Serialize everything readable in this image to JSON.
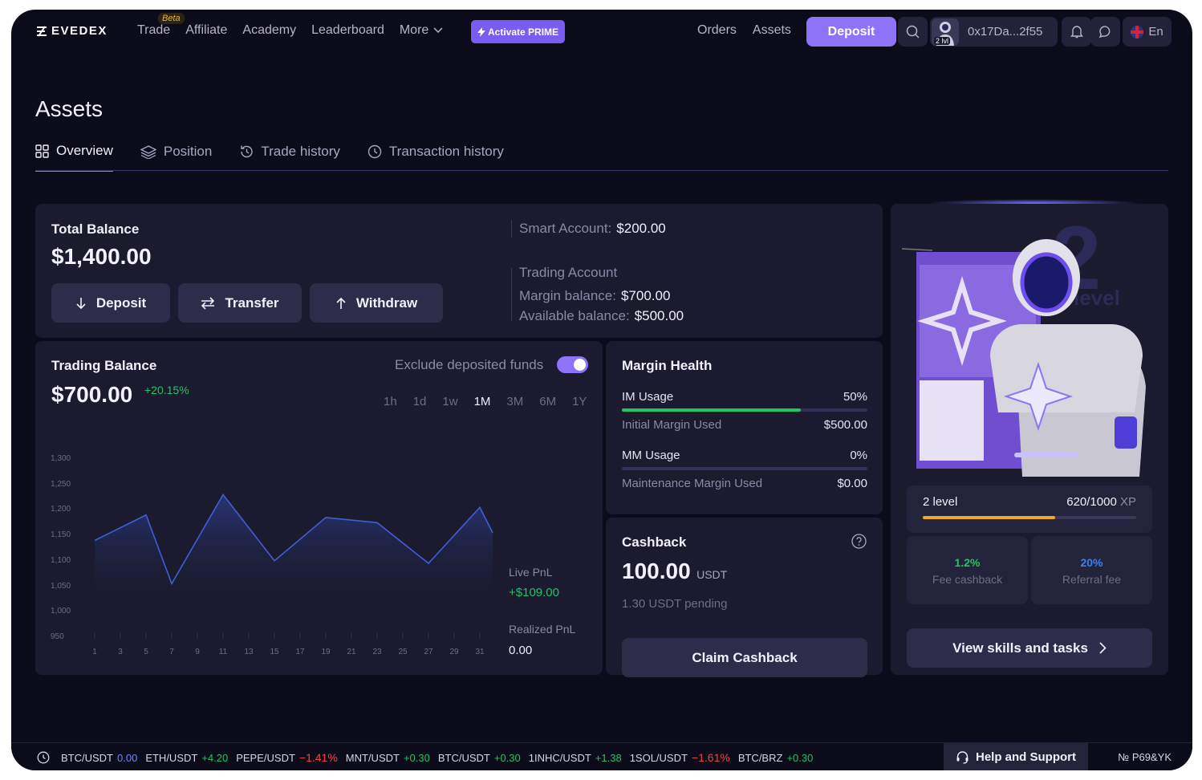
{
  "header": {
    "logo": "EVEDEX",
    "nav": [
      "Trade",
      "Affiliate",
      "Academy",
      "Leaderboard",
      "More"
    ],
    "beta_badge": "Beta",
    "prime_label": "Activate PRIME",
    "links": [
      "Orders",
      "Assets"
    ],
    "deposit_label": "Deposit",
    "avatar_level": "2 lvl",
    "wallet_address": "0x17Da...2f55",
    "language": "En"
  },
  "page": {
    "title": "Assets",
    "tabs": [
      "Overview",
      "Position",
      "Trade history",
      "Transaction history"
    ],
    "active_tab": "Overview"
  },
  "total_balance": {
    "label": "Total Balance",
    "value": "$1,400.00",
    "actions": [
      "Deposit",
      "Transfer",
      "Withdraw"
    ],
    "smart_account_label": "Smart Account:",
    "smart_account_value": "$200.00",
    "trading_account_label": "Trading Account",
    "margin_balance_label": "Margin balance:",
    "margin_balance_value": "$700.00",
    "available_balance_label": "Available balance:",
    "available_balance_value": "$500.00"
  },
  "trading_balance": {
    "label": "Trading Balance",
    "value": "$700.00",
    "change": "+20.15%",
    "exclude_label": "Exclude deposited funds",
    "exclude_enabled": true,
    "periods": [
      "1h",
      "1d",
      "1w",
      "1M",
      "3M",
      "6M",
      "1Y"
    ],
    "selected_period": "1M",
    "live_pnl_label": "Live PnL",
    "live_pnl_value": "+$109.00",
    "realized_pnl_label": "Realized PnL",
    "realized_pnl_value": "0.00"
  },
  "chart_data": {
    "type": "area",
    "x": [
      1,
      3,
      5,
      7,
      9,
      11,
      13,
      15,
      17,
      19,
      21,
      23,
      25,
      27,
      29,
      31
    ],
    "x_points": [
      1,
      5,
      7,
      11,
      15,
      19,
      23,
      27,
      31,
      32
    ],
    "y_points": [
      1140,
      1190,
      1055,
      1230,
      1100,
      1185,
      1175,
      1095,
      1205,
      1155
    ],
    "yticks": [
      1300,
      1250,
      1200,
      1150,
      1100,
      1050,
      1000,
      950
    ],
    "ytick_labels": [
      "1,300",
      "1,250",
      "1,200",
      "1,150",
      "1,100",
      "1,050",
      "1,000",
      "950"
    ],
    "ylim": [
      950,
      1300
    ],
    "xlim": [
      0,
      32
    ],
    "color": "#3f5fd6"
  },
  "margin_health": {
    "title": "Margin Health",
    "im_label": "IM Usage",
    "im_value": "50%",
    "im_fraction": 0.73,
    "initial_label": "Initial Margin Used",
    "initial_value": "$500.00",
    "mm_label": "MM Usage",
    "mm_value": "0%",
    "mm_fraction": 0,
    "maintenance_label": "Maintenance Margin Used",
    "maintenance_value": "$0.00"
  },
  "cashback": {
    "title": "Cashback",
    "value": "100.00",
    "unit": "USDT",
    "pending": "1.30 USDT pending",
    "claim_label": "Claim Cashback"
  },
  "level": {
    "big_number": "2",
    "big_word": "level",
    "level_label": "2 level",
    "xp_value": "620/1000",
    "xp_unit": "XP",
    "xp_fraction": 0.62,
    "fee_cashback_value": "1.2%",
    "fee_cashback_label": "Fee cashback",
    "referral_value": "20%",
    "referral_label": "Referral fee",
    "skills_label": "View skills and tasks"
  },
  "footer": {
    "ticker": [
      {
        "pair": "BTC/USDT",
        "change": "0.00",
        "color": "#6f86ff"
      },
      {
        "pair": "ETH/USDT",
        "change": "+4.20",
        "color": "#22c55e"
      },
      {
        "pair": "PEPE/USDT",
        "change": "−1.41%",
        "color": "#ef4444"
      },
      {
        "pair": "MNT/USDT",
        "change": "+0.30",
        "color": "#22c55e"
      },
      {
        "pair": "BTC/USDT",
        "change": "+0.30",
        "color": "#22c55e"
      },
      {
        "pair": "1INHC/USDT",
        "change": "+1.38",
        "color": "#22c55e"
      },
      {
        "pair": "1SOL/USDT",
        "change": "−1.61%",
        "color": "#ef4444"
      },
      {
        "pair": "BTC/BRZ",
        "change": "+0.30",
        "color": "#22c55e"
      }
    ],
    "help_label": "Help and Support",
    "ticket": "№ P69&YK"
  },
  "colors": {
    "accent": "#8f73f7",
    "positive": "#22c55e",
    "negative": "#ef4444",
    "xp_bar": "#f5a623",
    "referral": "#3b82f6"
  }
}
